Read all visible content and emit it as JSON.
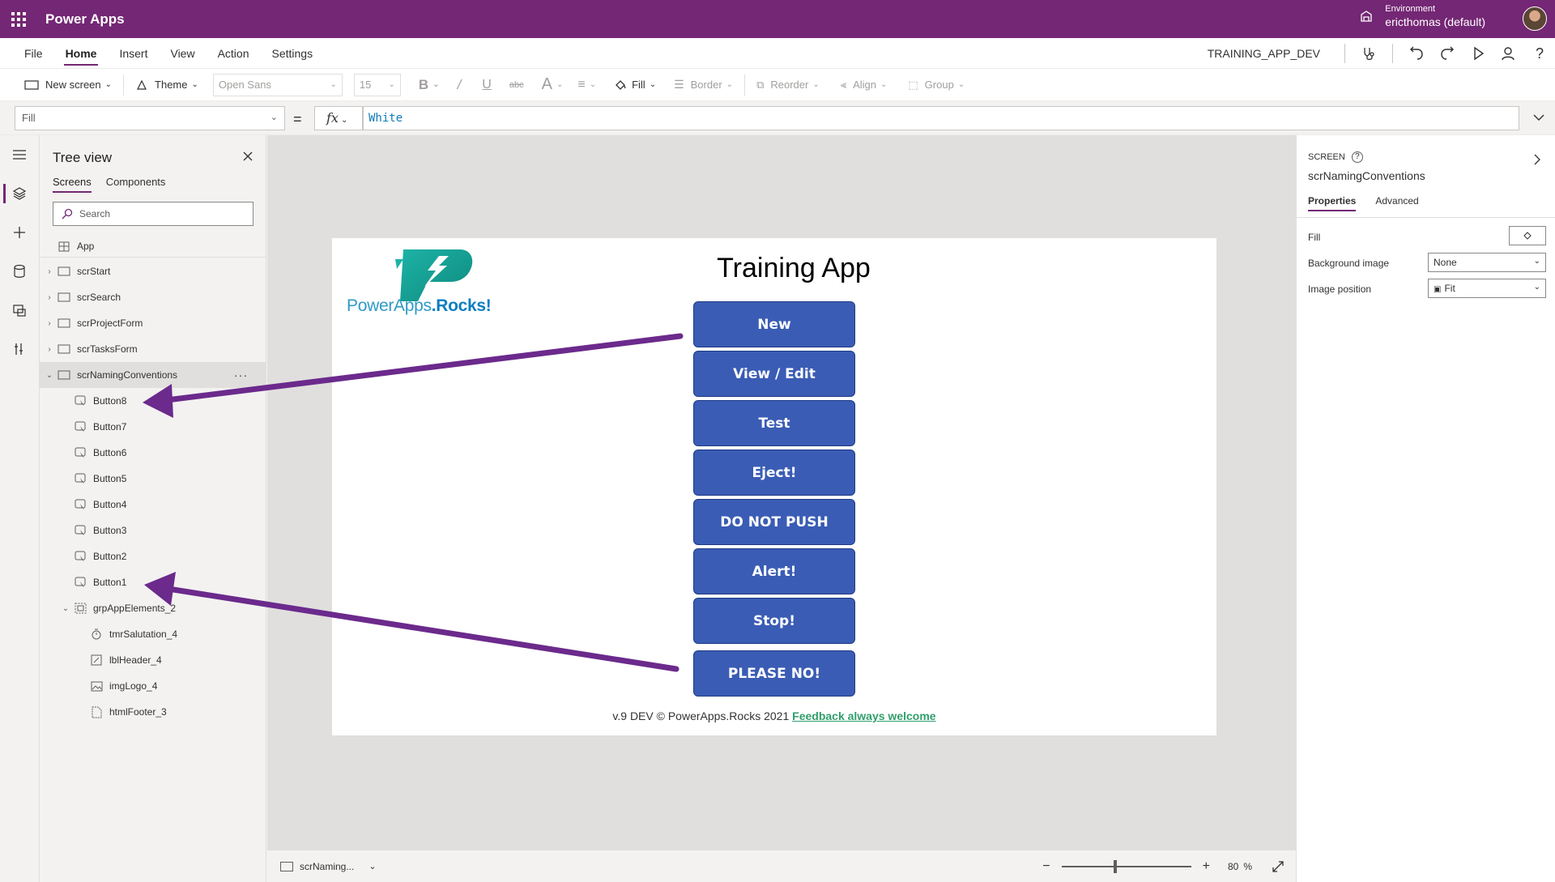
{
  "topbar": {
    "app_name": "Power Apps",
    "env_label": "Environment",
    "env_value": "ericthomas (default)"
  },
  "menu": {
    "items": [
      "File",
      "Home",
      "Insert",
      "View",
      "Action",
      "Settings"
    ],
    "active": "Home",
    "app_title": "TRAINING_APP_DEV"
  },
  "ribbon": {
    "new_screen": "New screen",
    "theme": "Theme",
    "font": "Open Sans",
    "font_size": "15",
    "fill": "Fill",
    "border": "Border",
    "reorder": "Reorder",
    "align": "Align",
    "group": "Group"
  },
  "formula_bar": {
    "property": "Fill",
    "fx": "fx",
    "formula": "White"
  },
  "tree": {
    "title": "Tree view",
    "tabs": [
      "Screens",
      "Components"
    ],
    "search_placeholder": "Search",
    "app_label": "App",
    "screens": [
      "scrStart",
      "scrSearch",
      "scrProjectForm",
      "scrTasksForm",
      "scrNamingConventions"
    ],
    "children": [
      "Button8",
      "Button7",
      "Button6",
      "Button5",
      "Button4",
      "Button3",
      "Button2",
      "Button1",
      "grpAppElements_2"
    ],
    "group_children": [
      "tmrSalutation_4",
      "lblHeader_4",
      "imgLogo_4",
      "htmlFooter_3"
    ]
  },
  "screen": {
    "title": "Training App",
    "logo_text_1": "PowerApps",
    "logo_text_2": ".Rocks!",
    "buttons": [
      "New",
      "View / Edit",
      "Test",
      "Eject!",
      "DO NOT PUSH",
      "Alert!",
      "Stop!",
      "PLEASE NO!"
    ],
    "footer_text": "v.9 DEV © PowerApps.Rocks 2021",
    "footer_link": "Feedback always welcome"
  },
  "statusbar": {
    "screen": "scrNaming...",
    "zoom": "80",
    "zoom_unit": "%"
  },
  "props": {
    "kind": "SCREEN",
    "name": "scrNamingConventions",
    "tabs": [
      "Properties",
      "Advanced"
    ],
    "fill_label": "Fill",
    "bg_label": "Background image",
    "bg_value": "None",
    "pos_label": "Image position",
    "pos_value": "Fit"
  },
  "colors": {
    "brand": "#742774",
    "button": "#3a5cb4",
    "arrow": "#6b2a8c",
    "link": "#2f9e6b"
  }
}
